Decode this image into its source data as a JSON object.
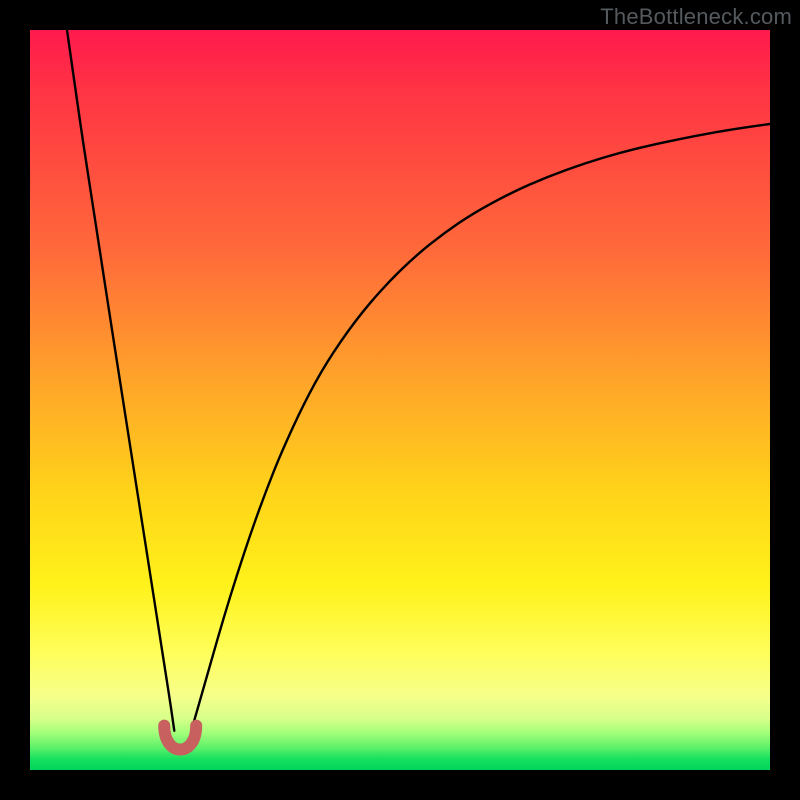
{
  "watermark": "TheBottleneck.com",
  "colors": {
    "frame": "#000000",
    "curve_stroke": "#000000",
    "cusp_marker": "#c7605f"
  },
  "chart_data": {
    "type": "line",
    "title": "",
    "xlabel": "",
    "ylabel": "",
    "xlim": [
      0,
      100
    ],
    "ylim": [
      0,
      100
    ],
    "grid": false,
    "series": [
      {
        "name": "left-branch",
        "x": [
          5,
          6,
          7,
          8,
          9,
          10,
          11,
          12,
          13,
          14,
          15,
          16,
          17,
          18,
          19,
          19.5
        ],
        "values": [
          100,
          93,
          86,
          79.5,
          73,
          66.5,
          60,
          53.6,
          47.2,
          40.8,
          34.4,
          28,
          21.6,
          15.2,
          8.8,
          5.3
        ]
      },
      {
        "name": "right-branch",
        "x": [
          22,
          24,
          26,
          28,
          30,
          32,
          34,
          37,
          40,
          44,
          48,
          52,
          56,
          60,
          65,
          70,
          75,
          80,
          85,
          90,
          95,
          100
        ],
        "values": [
          6,
          13,
          20,
          26.5,
          32.5,
          38,
          43,
          49.5,
          55,
          60.8,
          65.5,
          69.4,
          72.6,
          75.3,
          78.0,
          80.2,
          82.0,
          83.5,
          84.7,
          85.7,
          86.6,
          87.3
        ]
      }
    ],
    "annotations": [
      {
        "name": "cusp-marker",
        "shape": "u",
        "x": 20.3,
        "y": 3.3,
        "color": "#c7605f"
      }
    ],
    "background_gradient": {
      "type": "vertical-heat",
      "top": "#ff1a4d",
      "mid": "#ffd21a",
      "bottom": "#00d45a"
    }
  }
}
